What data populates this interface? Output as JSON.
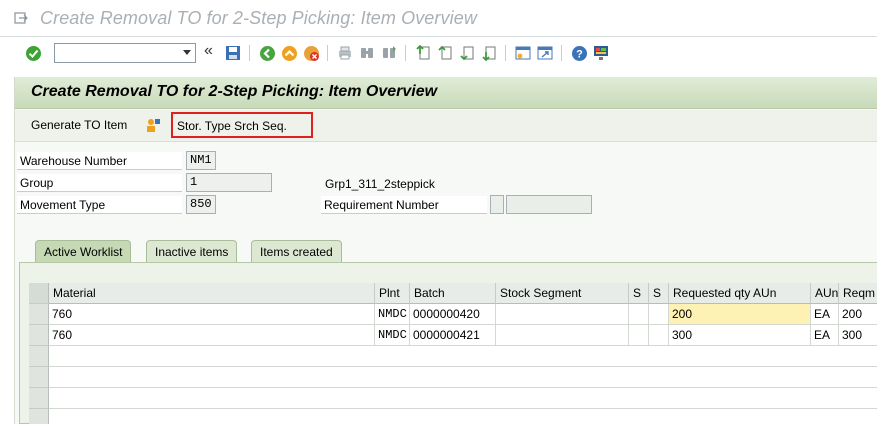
{
  "window": {
    "title": "Create Removal TO for 2-Step Picking: Item Overview"
  },
  "toolbar": {
    "command_value": "",
    "icons": [
      "enter-icon",
      "save-icon",
      "back-icon",
      "exit-icon",
      "cancel-icon",
      "print-icon",
      "find-icon",
      "find-next-icon",
      "first-page-icon",
      "previous-page-icon",
      "next-page-icon",
      "last-page-icon",
      "create-session-icon",
      "shortcut-icon",
      "help-icon",
      "customize-layout-icon"
    ]
  },
  "app": {
    "header": "Create Removal TO for 2-Step Picking: Item Overview",
    "buttons": {
      "generate_to_item": "Generate TO Item",
      "stor_type_srch_seq": "Stor. Type Srch Seq."
    }
  },
  "form": {
    "warehouse_number": {
      "label": "Warehouse Number",
      "value": "NM1"
    },
    "group": {
      "label": "Group",
      "value": "1",
      "description": "Grp1_311_2steppick"
    },
    "movement_type": {
      "label": "Movement Type",
      "value": "850"
    },
    "requirement_number": {
      "label": "Requirement Number",
      "value1": "",
      "value2": ""
    }
  },
  "tabs": [
    {
      "label": "Active Worklist",
      "active": true
    },
    {
      "label": "Inactive items",
      "active": false
    },
    {
      "label": "Items created",
      "active": false
    }
  ],
  "table": {
    "columns": [
      "Material",
      "Plnt",
      "Batch",
      "Stock Segment",
      "S",
      "S",
      "Requested qty AUn",
      "AUn",
      "Reqm"
    ],
    "rows": [
      {
        "material": "760",
        "plnt": "NMDC",
        "batch": "0000000420",
        "stock_segment": "",
        "s1": "",
        "s2": "",
        "requested_qty": "200",
        "aun": "EA",
        "reqm": "200"
      },
      {
        "material": "760",
        "plnt": "NMDC",
        "batch": "0000000421",
        "stock_segment": "",
        "s1": "",
        "s2": "",
        "requested_qty": "300",
        "aun": "EA",
        "reqm": "300"
      }
    ]
  },
  "colors": {
    "highlight_border": "#e02020",
    "header_green": "#c8dab9",
    "edit_yellow": "#fdf2b3"
  }
}
